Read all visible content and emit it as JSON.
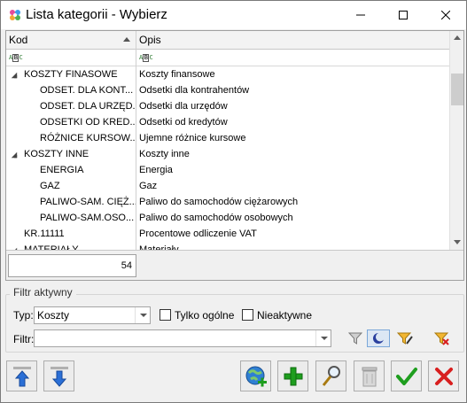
{
  "window": {
    "title": "Lista kategorii - Wybierz",
    "icon": "app-flower-icon"
  },
  "grid": {
    "columns": [
      {
        "id": "kod",
        "label": "Kod",
        "sorted": "ascending"
      },
      {
        "id": "opis",
        "label": "Opis"
      }
    ],
    "rows": [
      {
        "kod": "KOSZTY FINASOWE",
        "opis": "Koszty finansowe",
        "level": 0,
        "expanded": true
      },
      {
        "kod": "ODSET. DLA KONT...",
        "opis": "Odsetki dla kontrahentów",
        "level": 1
      },
      {
        "kod": "ODSET. DLA URZĘD...",
        "opis": "Odsetki dla urzędów",
        "level": 1
      },
      {
        "kod": "ODSETKI OD KRED...",
        "opis": "Odsetki od kredytów",
        "level": 1
      },
      {
        "kod": "RÓŻNICE KURSOW...",
        "opis": "Ujemne różnice kursowe",
        "level": 1
      },
      {
        "kod": "KOSZTY INNE",
        "opis": "Koszty inne",
        "level": 0,
        "expanded": true
      },
      {
        "kod": "ENERGIA",
        "opis": "Energia",
        "level": 1
      },
      {
        "kod": "GAZ",
        "opis": "Gaz",
        "level": 1
      },
      {
        "kod": "PALIWO-SAM. CIĘŻ...",
        "opis": "Paliwo do samochodów ciężarowych",
        "level": 1
      },
      {
        "kod": "PALIWO-SAM.OSO...",
        "opis": "Paliwo do samochodów osobowych",
        "level": 1
      },
      {
        "kod": "KR.11111",
        "opis": "Procentowe odliczenie VAT",
        "level": 0
      },
      {
        "kod": "MATERIAŁY",
        "opis": "Materiały",
        "level": 0,
        "expanded": true
      }
    ],
    "count": "54"
  },
  "filter": {
    "group_title": "Filtr aktywny",
    "typ_label": "Typ:",
    "typ_value": "Koszty",
    "tylko_ogolne_label": "Tylko ogólne",
    "tylko_ogolne_checked": false,
    "nieaktywne_label": "Nieaktywne",
    "nieaktywne_checked": false,
    "filtr_label": "Filtr:",
    "filtr_value": ""
  },
  "colors": {
    "green_check": "#1e9e1e",
    "red_x": "#d81e1e",
    "blue_arrow": "#2a6fd6"
  }
}
